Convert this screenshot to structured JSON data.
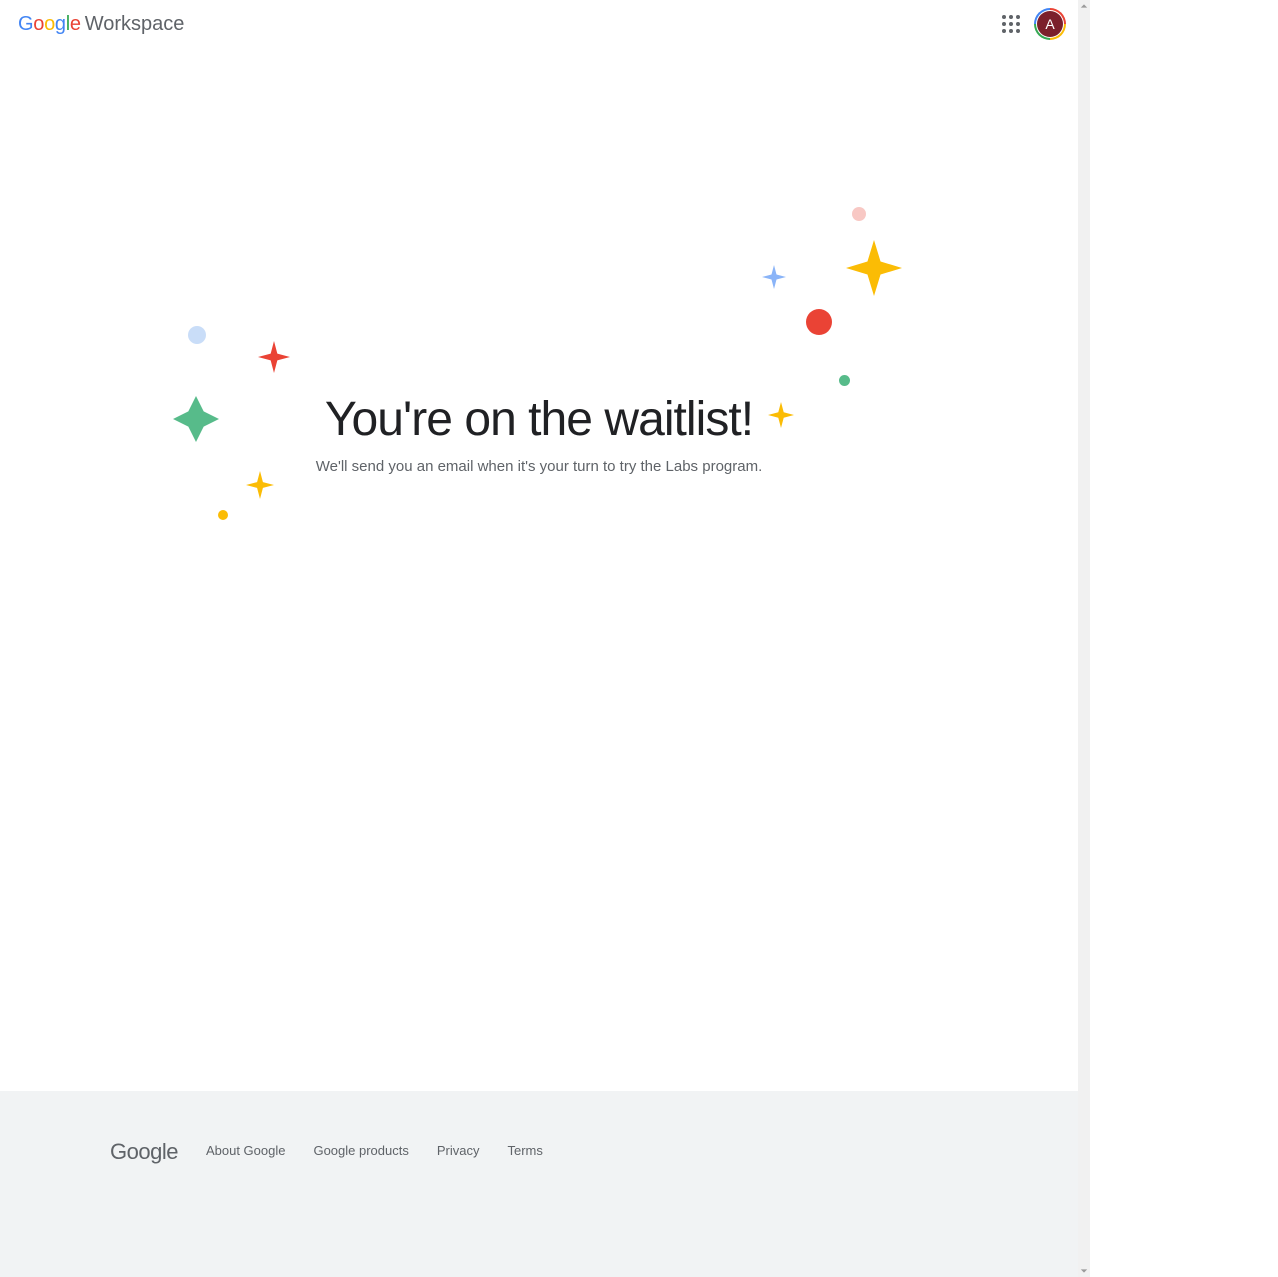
{
  "header": {
    "product_word": "Workspace",
    "avatar_initial": "A"
  },
  "hero": {
    "title": "You're on the waitlist!",
    "subtitle": "We'll send you an email when it's your turn to try the Labs program."
  },
  "footer": {
    "logo": "Google",
    "links": [
      "About Google",
      "Google products",
      "Privacy",
      "Terms"
    ]
  },
  "colors": {
    "blue": "#4285F4",
    "red": "#EA4335",
    "yellow": "#FBBC05",
    "green": "#34A853",
    "pink": "#FAD2CF"
  }
}
